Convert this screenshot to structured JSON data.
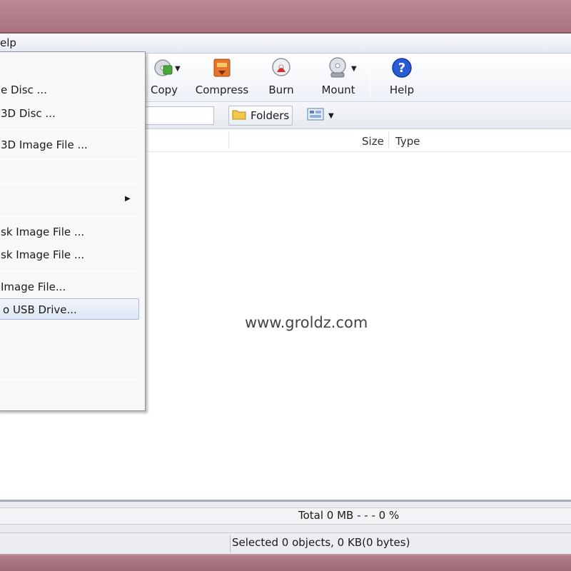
{
  "menubar": {
    "help_fragment": "elp"
  },
  "toolbar": {
    "copy": "Copy",
    "compress": "Compress",
    "burn": "Burn",
    "mount": "Mount",
    "help": "Help"
  },
  "addressbar": {
    "folders": "Folders"
  },
  "columns": {
    "size": "Size",
    "type": "Type"
  },
  "dropdown": {
    "items": [
      "e Disc ...",
      "3D Disc ...",
      "3D Image File ...",
      "sk Image File ...",
      "sk Image File ...",
      " Image File...",
      "o USB Drive..."
    ]
  },
  "watermark": "www.groldz.com",
  "progress": {
    "text": "Total  0 MB   - - -  0 %"
  },
  "status": {
    "text": "Selected 0 objects, 0 KB(0 bytes)"
  },
  "icons": {
    "copy": "copy-disc-icon",
    "compress": "compress-icon",
    "burn": "burn-disc-icon",
    "mount": "mount-disc-icon",
    "help": "help-icon",
    "folders": "folder-icon",
    "view": "view-icon"
  },
  "colors": {
    "frame": "#a9737f",
    "highlight": "#dde7f4",
    "help_blue": "#2a5bd7"
  }
}
